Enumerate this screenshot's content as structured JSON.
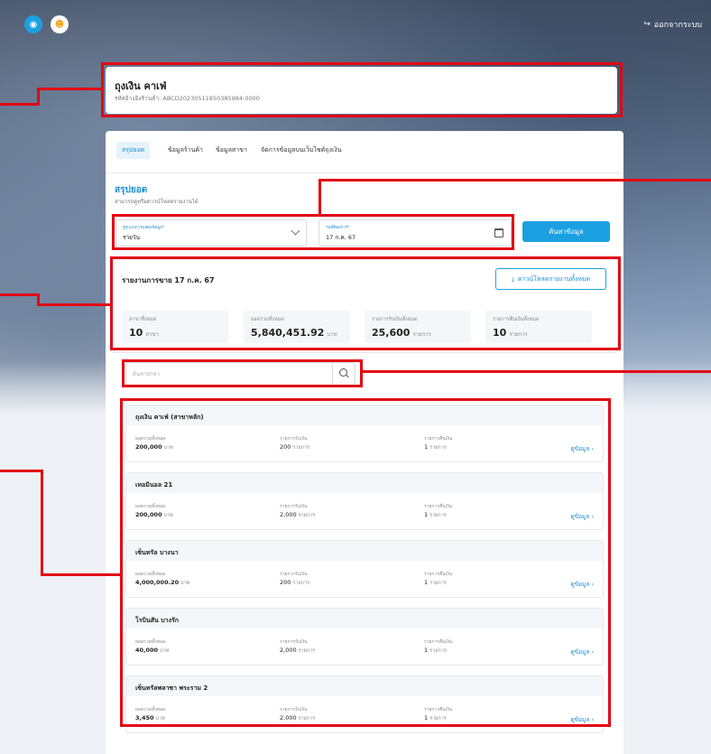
{
  "header": {
    "logout_label": "ออกจากระบบ"
  },
  "shop": {
    "name": "ถุงเงิน คาเฟ่",
    "code": "รหัสอ้างอิงร้านค้า: ABCD20230511850385984-0000"
  },
  "tabs": [
    {
      "label": "สรุปยอด"
    },
    {
      "label": "ข้อมูลร้านค้า"
    },
    {
      "label": "ข้อมูลสาขา"
    },
    {
      "label": "จัดการข้อมูลบนเว็บไซต์ถุงเงิน"
    }
  ],
  "summary": {
    "title": "สรุปยอด",
    "subtitle": "สามารถดูหรือดาวน์โหลดรายงานได้"
  },
  "filters": {
    "type_label": "รูปแบบการแสดงข้อมูล*",
    "type_value": "รายวัน",
    "date_label": "วันที่ต้องการ*",
    "date_value": "17 ก.ค. 67",
    "search_label": "ค้นหาข้อมูล"
  },
  "report": {
    "title": "รายงานการขาย 17 ก.ค. 67",
    "download_label": "ดาวน์โหลดรายงานทั้งหมด",
    "stats": [
      {
        "label": "สาขาทั้งหมด",
        "value": "10",
        "unit": "สาขา"
      },
      {
        "label": "ยอดรวมทั้งหมด",
        "value": "5,840,451.92",
        "unit": "บาท"
      },
      {
        "label": "รายการรับเงินทั้งหมด",
        "value": "25,600",
        "unit": "รายการ"
      },
      {
        "label": "รายการคืนเงินทั้งหมด",
        "value": "10",
        "unit": "รายการ"
      }
    ]
  },
  "branch_search": {
    "placeholder": "ค้นหาสาขา"
  },
  "branch_labels": {
    "total": "ยอดรวมทั้งหมด",
    "receive": "รายการรับเงิน",
    "refund": "รายการคืนเงิน",
    "more": "ดูข้อมูล"
  },
  "branches": [
    {
      "name": "ถุงเงิน คาเฟ่ (สาขาหลัก)",
      "total": "200,000",
      "total_unit": "บาท",
      "receive": "200",
      "receive_unit": "รายการ",
      "refund": "1",
      "refund_unit": "รายการ"
    },
    {
      "name": "เทอมินอล 21",
      "total": "200,000",
      "total_unit": "บาท",
      "receive": "2,000",
      "receive_unit": "รายการ",
      "refund": "1",
      "refund_unit": "รายการ"
    },
    {
      "name": "เซ็นทรัล บางนา",
      "total": "4,000,000.20",
      "total_unit": "บาท",
      "receive": "200",
      "receive_unit": "รายการ",
      "refund": "1",
      "refund_unit": "รายการ"
    },
    {
      "name": "โรบินสัน บางรัก",
      "total": "40,000",
      "total_unit": "บาท",
      "receive": "2,000",
      "receive_unit": "รายการ",
      "refund": "1",
      "refund_unit": "รายการ"
    },
    {
      "name": "เซ็นทรัลพลาซา พระราม 2",
      "total": "3,450",
      "total_unit": "บาท",
      "receive": "2,000",
      "receive_unit": "รายการ",
      "refund": "1",
      "refund_unit": "รายการ"
    }
  ],
  "colors": {
    "accent": "#1ba1e2",
    "annotation": "#e30613"
  }
}
